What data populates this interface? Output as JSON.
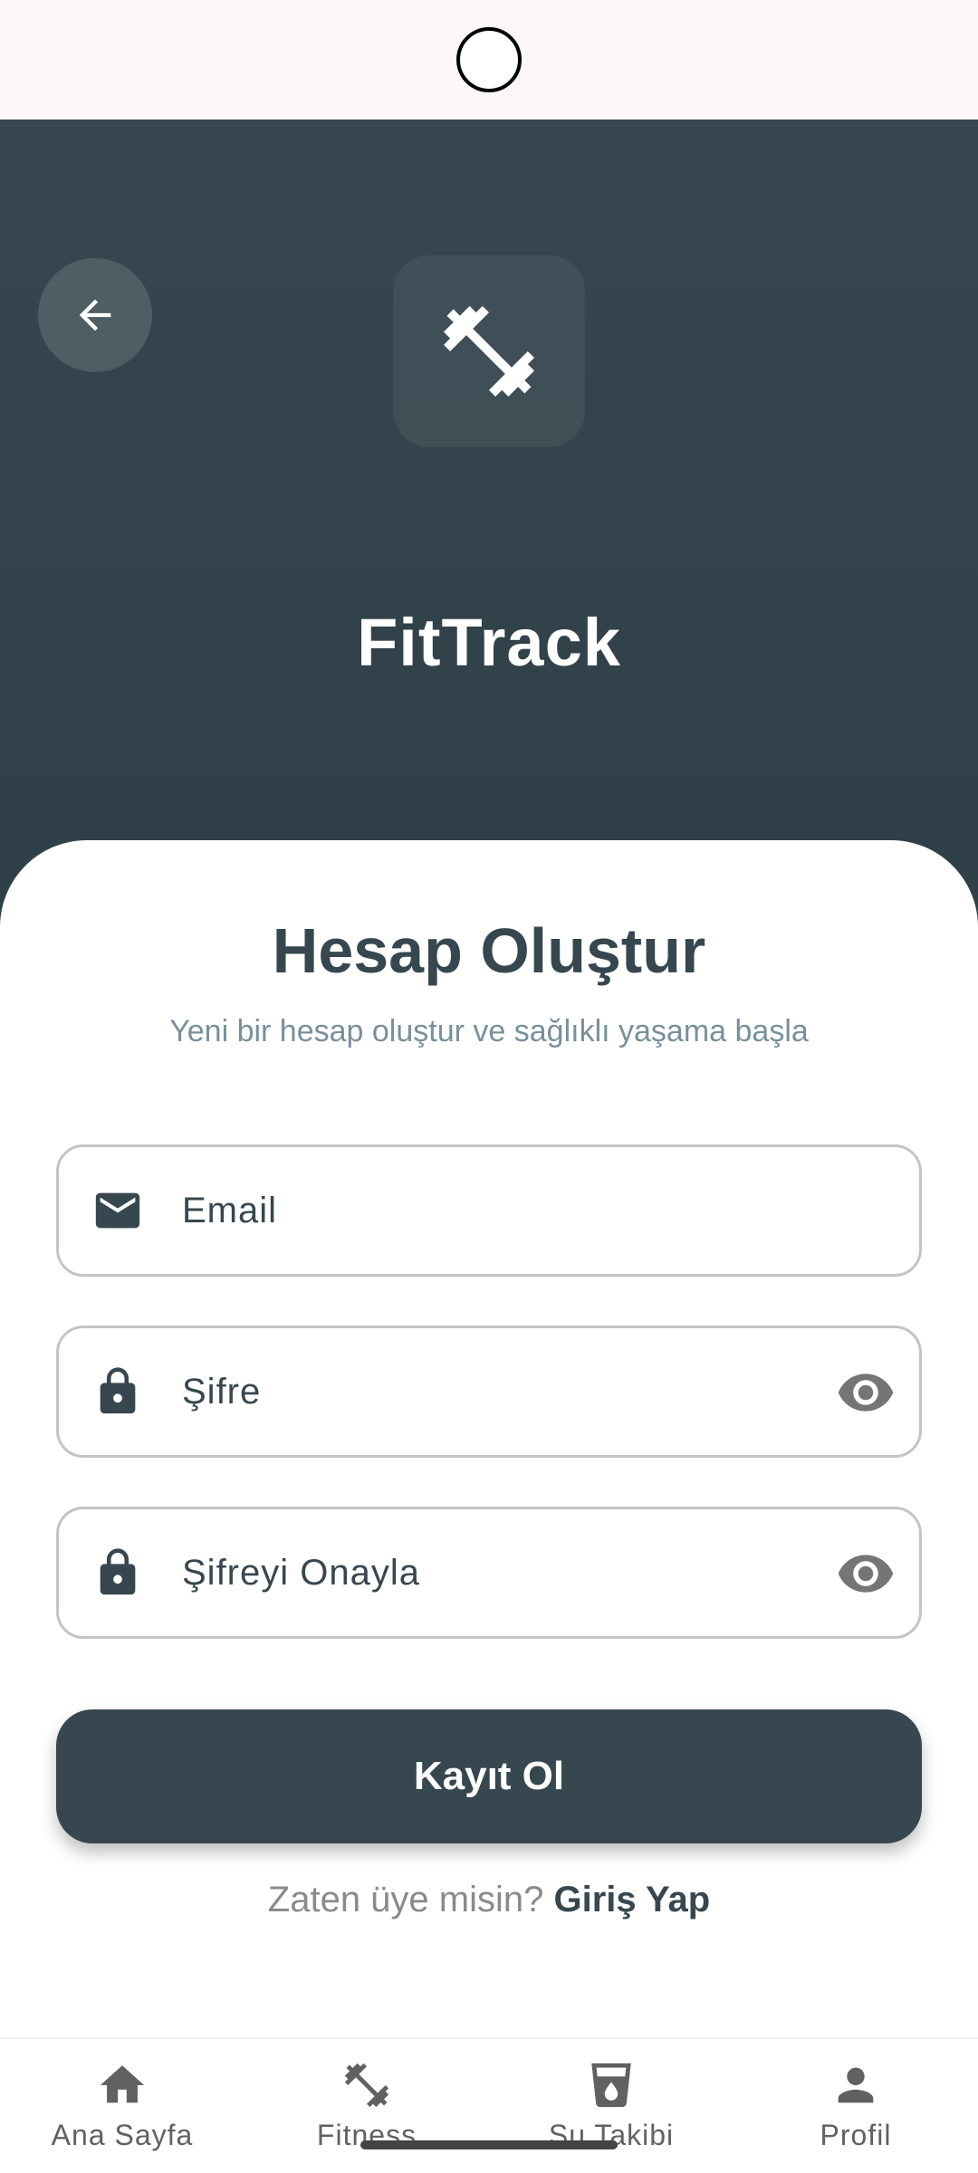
{
  "app": {
    "title": "FitTrack"
  },
  "card": {
    "title": "Hesap Oluştur",
    "subtitle": "Yeni bir hesap oluştur ve sağlıklı yaşama başla"
  },
  "fields": {
    "email": {
      "placeholder": "Email",
      "icon": "mail-icon"
    },
    "password": {
      "placeholder": "Şifre",
      "icon": "lock-icon",
      "trailing_icon": "eye-icon"
    },
    "confirm_password": {
      "placeholder": "Şifreyi Onayla",
      "icon": "lock-icon",
      "trailing_icon": "eye-icon"
    }
  },
  "buttons": {
    "register": "Kayıt Ol"
  },
  "login_prompt": {
    "text": "Zaten üye misin?",
    "link": "Giriş Yap"
  },
  "bottom_nav": {
    "items": [
      {
        "label": "Ana Sayfa",
        "icon": "home-icon"
      },
      {
        "label": "Fitness",
        "icon": "dumbbell-icon"
      },
      {
        "label": "Su Takibi",
        "icon": "water-glass-icon"
      },
      {
        "label": "Profil",
        "icon": "person-icon"
      }
    ]
  },
  "colors": {
    "primary": "#37474f",
    "subtitle": "#78909c",
    "header_bg": "#37474f",
    "status_bar_bg": "#fdf7fb"
  }
}
